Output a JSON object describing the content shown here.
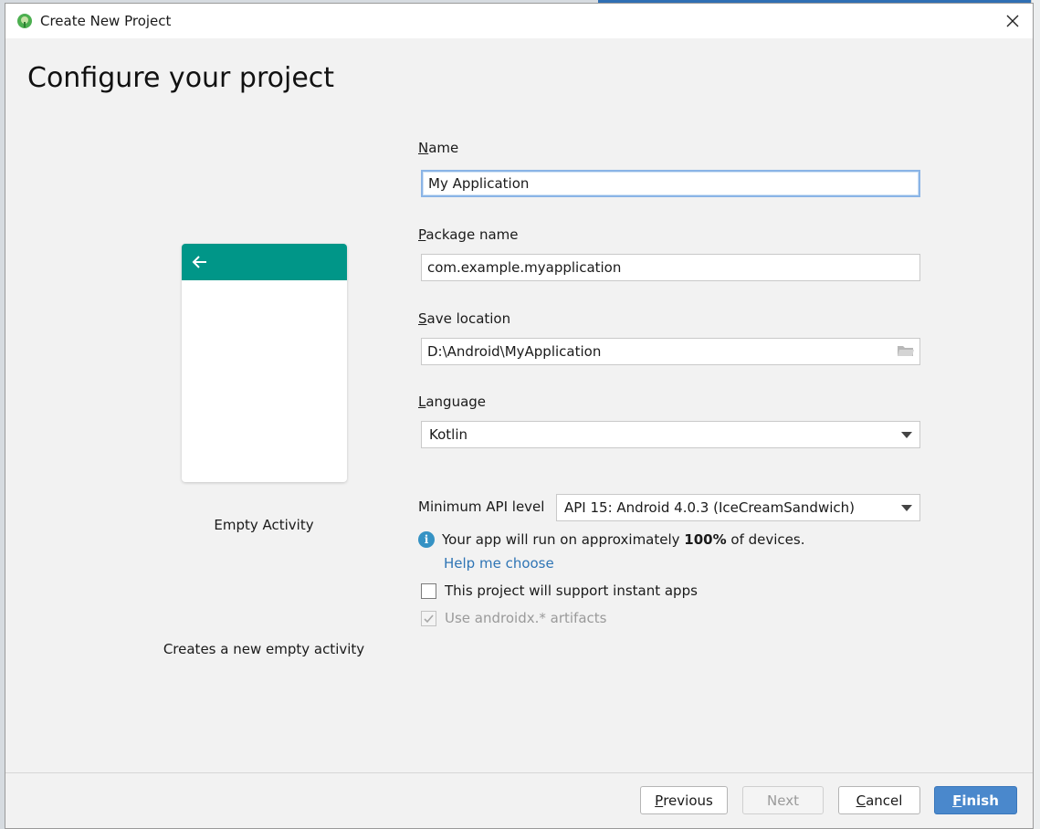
{
  "window": {
    "title": "Create New Project",
    "heading": "Configure your project"
  },
  "preview": {
    "activity_name": "Empty Activity",
    "description": "Creates a new empty activity",
    "bar_color": "#009688"
  },
  "form": {
    "name": {
      "mnemonic": "N",
      "label_rest": "ame",
      "value": "My Application"
    },
    "package": {
      "mnemonic": "P",
      "label_rest": "ackage name",
      "value": "com.example.myapplication"
    },
    "save_location": {
      "mnemonic": "S",
      "label_rest": "ave location",
      "value": "D:\\Android\\MyApplication"
    },
    "language": {
      "mnemonic": "L",
      "label_rest": "anguage",
      "value": "Kotlin"
    },
    "min_api": {
      "label": "Minimum API level",
      "value": "API 15: Android 4.0.3 (IceCreamSandwich)"
    },
    "info": {
      "prefix": "Your app will run on approximately ",
      "percent": "100%",
      "suffix": " of devices."
    },
    "help_link": "Help me choose",
    "instant_apps": {
      "label": "This project will support instant apps",
      "checked": false
    },
    "androidx": {
      "label": "Use androidx.* artifacts",
      "checked": true,
      "disabled": true
    }
  },
  "buttons": {
    "previous": {
      "mnemonic": "P",
      "rest": "revious"
    },
    "next": "Next",
    "cancel": {
      "mnemonic": "C",
      "rest": "ancel"
    },
    "finish": {
      "mnemonic": "F",
      "rest": "inish"
    }
  },
  "colors": {
    "accent": "#4a88cc",
    "link": "#2f75b5",
    "info": "#3592c4"
  }
}
